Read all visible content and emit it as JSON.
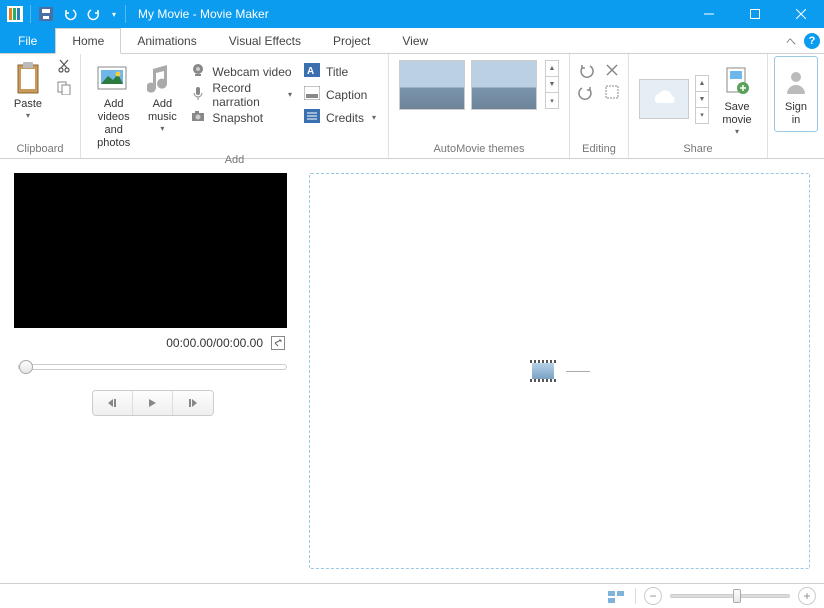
{
  "title": "My Movie - Movie Maker",
  "qat_icons": [
    "app-logo",
    "save-icon",
    "undo-icon",
    "redo-icon",
    "customize-qat-icon"
  ],
  "tabs": {
    "file": "File",
    "items": [
      "Home",
      "Animations",
      "Visual Effects",
      "Project",
      "View"
    ],
    "active": "Home"
  },
  "ribbon": {
    "clipboard": {
      "label": "Clipboard",
      "paste": "Paste"
    },
    "add": {
      "label": "Add",
      "add_videos": "Add videos\nand photos",
      "add_music": "Add\nmusic",
      "webcam": "Webcam video",
      "record": "Record narration",
      "snapshot": "Snapshot",
      "title_btn": "Title",
      "caption": "Caption",
      "credits": "Credits"
    },
    "automovie": {
      "label": "AutoMovie themes"
    },
    "editing": {
      "label": "Editing"
    },
    "share": {
      "label": "Share",
      "save_movie": "Save\nmovie"
    },
    "signin": {
      "label": "Sign\nin"
    }
  },
  "preview": {
    "time_current": "00:00.00",
    "time_total": "00:00.00"
  }
}
